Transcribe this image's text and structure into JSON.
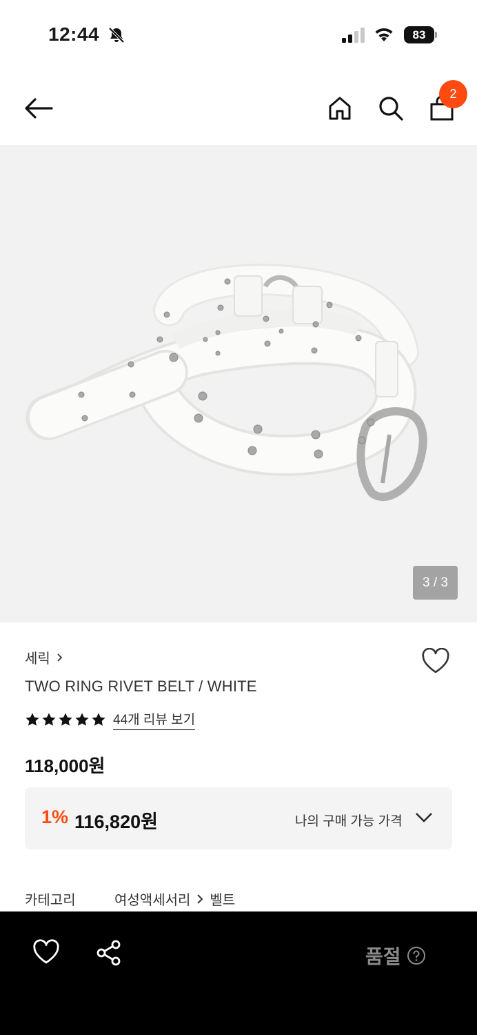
{
  "status_bar": {
    "time": "12:44",
    "battery": "83"
  },
  "header": {
    "cart_count": "2"
  },
  "gallery": {
    "counter": "3 / 3"
  },
  "product": {
    "brand": "세릭",
    "name": "TWO RING RIVET BELT / WHITE",
    "rating": 5,
    "review_link": "44개 리뷰 보기",
    "price": "118,000원",
    "discount_rate": "1%",
    "discount_price": "116,820원",
    "my_price_label": "나의 구매 가능 가격",
    "category_label": "카테고리",
    "category_path": [
      "여성액세서리",
      "벨트"
    ]
  },
  "bottom_bar": {
    "soldout_label": "품절"
  },
  "colors": {
    "accent": "#ff4b12",
    "bottom_bar": "#000000",
    "image_bg": "#f2f2f2"
  }
}
